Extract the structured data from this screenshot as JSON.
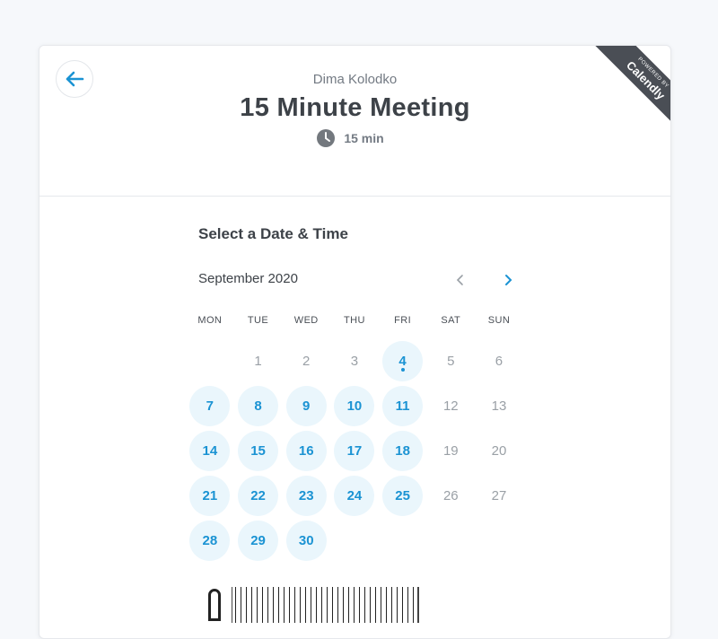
{
  "header": {
    "host_name": "Dima Kolodko",
    "event_title": "15 Minute Meeting",
    "duration": "15 min"
  },
  "ribbon": {
    "small": "POWERED BY",
    "brand": "Calendly"
  },
  "calendar": {
    "section_title": "Select a Date & Time",
    "month_label": "September 2020",
    "weekdays": [
      "MON",
      "TUE",
      "WED",
      "THU",
      "FRI",
      "SAT",
      "SUN"
    ],
    "days": [
      {
        "label": "",
        "status": "empty"
      },
      {
        "label": "1",
        "status": "unavailable"
      },
      {
        "label": "2",
        "status": "unavailable"
      },
      {
        "label": "3",
        "status": "unavailable"
      },
      {
        "label": "4",
        "status": "available",
        "today": true
      },
      {
        "label": "5",
        "status": "unavailable"
      },
      {
        "label": "6",
        "status": "unavailable"
      },
      {
        "label": "7",
        "status": "available"
      },
      {
        "label": "8",
        "status": "available"
      },
      {
        "label": "9",
        "status": "available"
      },
      {
        "label": "10",
        "status": "available"
      },
      {
        "label": "11",
        "status": "available"
      },
      {
        "label": "12",
        "status": "unavailable"
      },
      {
        "label": "13",
        "status": "unavailable"
      },
      {
        "label": "14",
        "status": "available"
      },
      {
        "label": "15",
        "status": "available"
      },
      {
        "label": "16",
        "status": "available"
      },
      {
        "label": "17",
        "status": "available"
      },
      {
        "label": "18",
        "status": "available"
      },
      {
        "label": "19",
        "status": "unavailable"
      },
      {
        "label": "20",
        "status": "unavailable"
      },
      {
        "label": "21",
        "status": "available"
      },
      {
        "label": "22",
        "status": "available"
      },
      {
        "label": "23",
        "status": "available"
      },
      {
        "label": "24",
        "status": "available"
      },
      {
        "label": "25",
        "status": "available"
      },
      {
        "label": "26",
        "status": "unavailable"
      },
      {
        "label": "27",
        "status": "unavailable"
      },
      {
        "label": "28",
        "status": "available"
      },
      {
        "label": "29",
        "status": "available"
      },
      {
        "label": "30",
        "status": "available"
      }
    ]
  },
  "colors": {
    "accent": "#1b93d3",
    "available_bg": "#eaf6fc",
    "ribbon": "#4a4e55"
  },
  "icons": {
    "back": "arrow-left-icon",
    "clock": "clock-icon",
    "prev": "chevron-left-icon",
    "next": "chevron-right-icon",
    "timezone": "globe-icon"
  }
}
